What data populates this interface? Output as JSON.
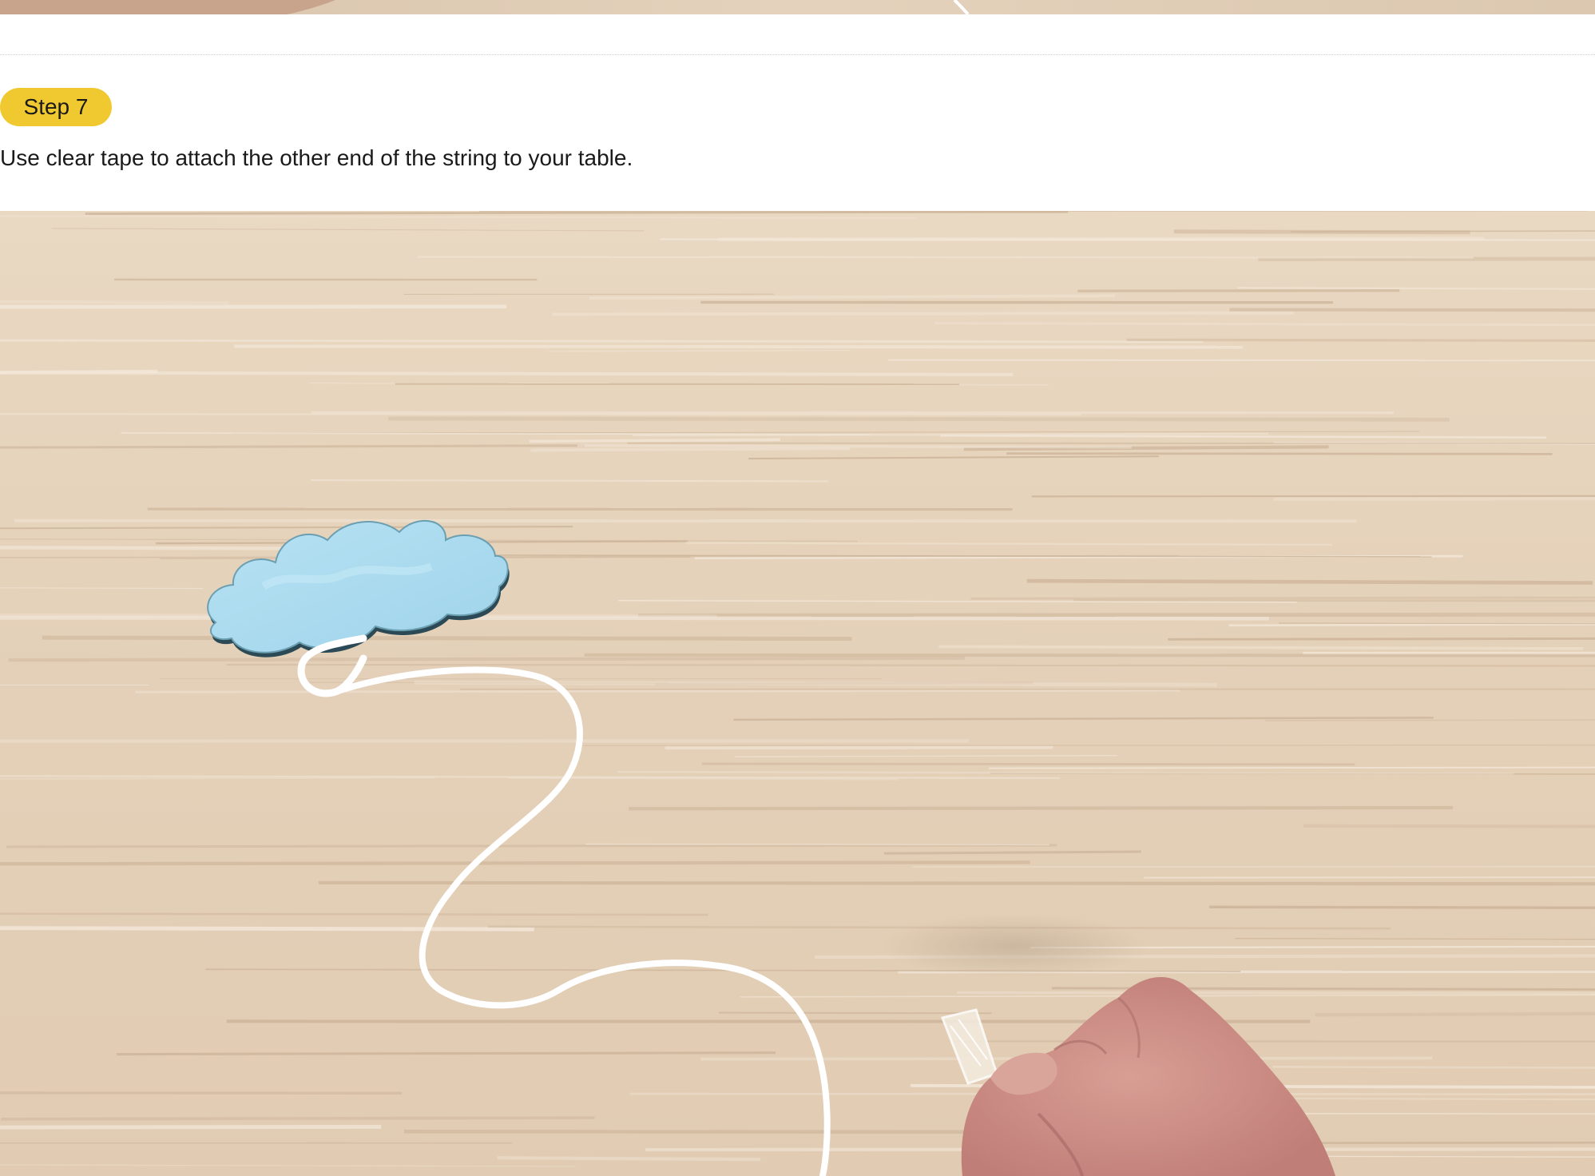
{
  "step": {
    "badge": "Step 7",
    "text": "Use clear tape to attach the other end of the string to your table.",
    "badge_color": "#f0c930"
  },
  "photo": {
    "subject": "paper-cloud-string-tape-photo",
    "wood_color": "#e6d3bc",
    "cloud_color": "#a9dbef"
  }
}
